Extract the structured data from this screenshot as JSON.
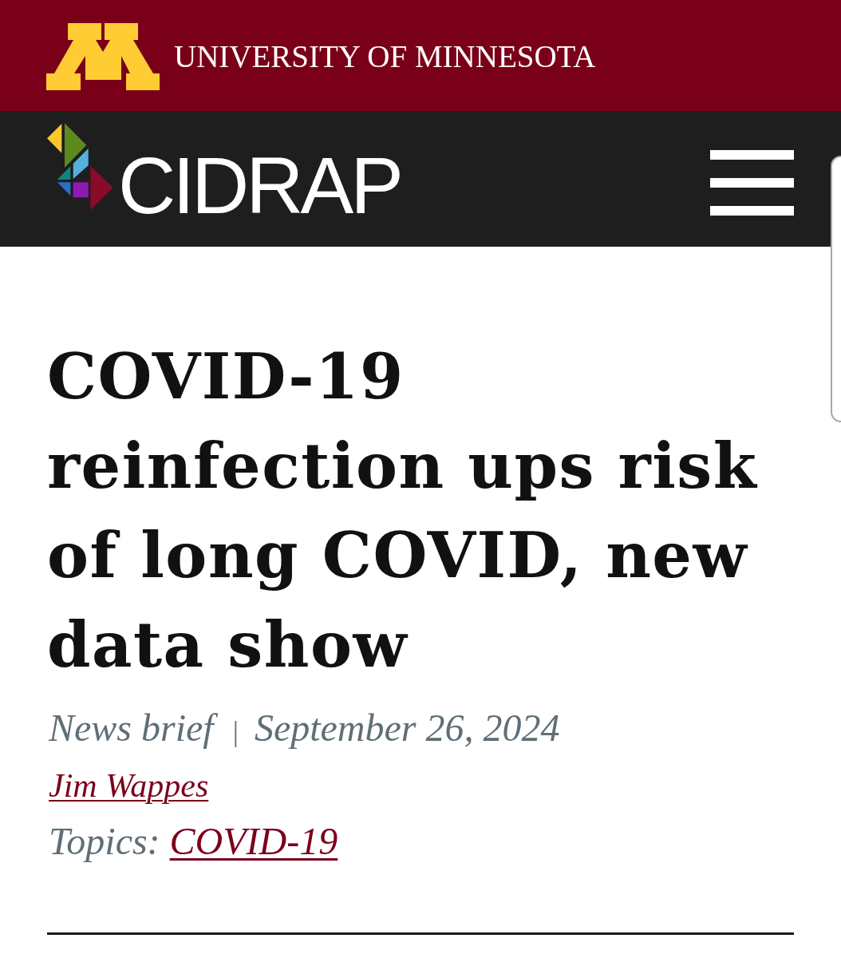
{
  "university_bar": {
    "wordmark": "UNIVERSITY OF MINNESOTA"
  },
  "site_header": {
    "logo_text": "CIDRAP"
  },
  "article": {
    "headline": "COVID-19 reinfection ups risk of long COVID, new data show",
    "type": "News brief",
    "separator": "|",
    "date": "September 26, 2024",
    "author": "Jim Wappes",
    "topics_label": "Topics:",
    "topics": [
      "COVID-19"
    ]
  }
}
